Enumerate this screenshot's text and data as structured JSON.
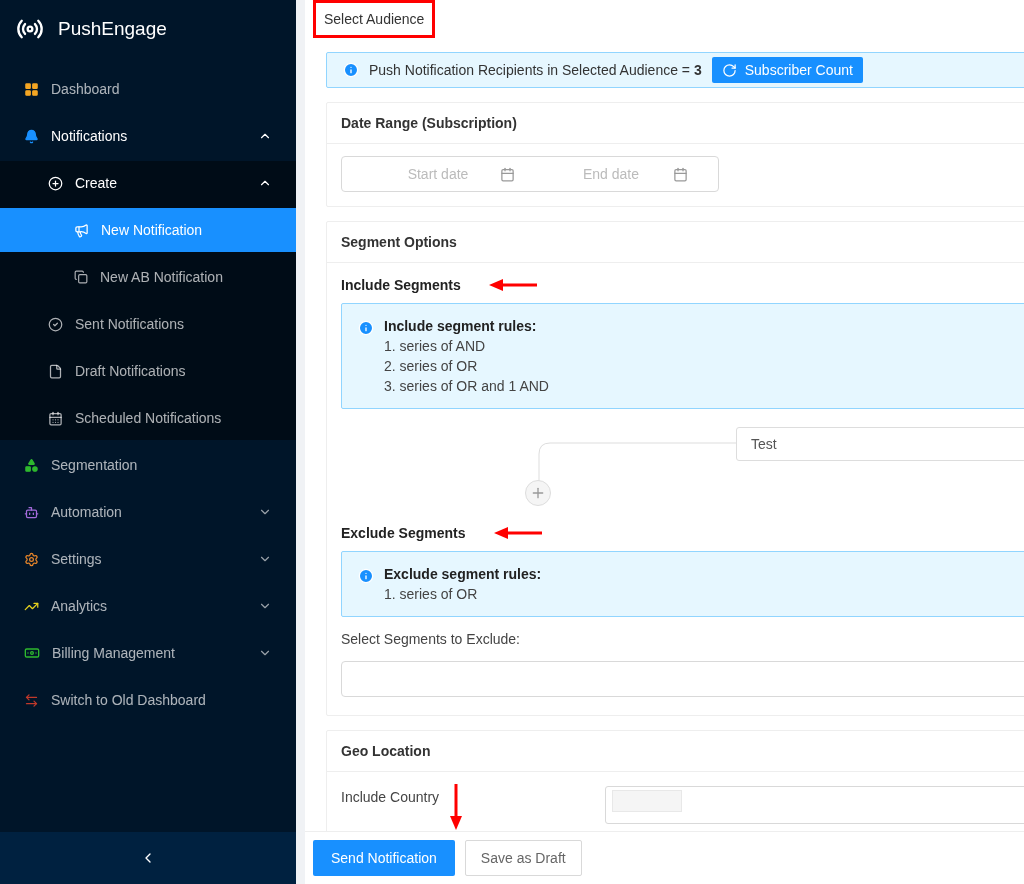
{
  "sidebar": {
    "brand": "PushEngage",
    "items": [
      {
        "label": "Dashboard",
        "selected": false
      },
      {
        "label": "Notifications",
        "selected": false,
        "expanded": true,
        "children": [
          {
            "label": "Create",
            "selected": false,
            "expanded": true,
            "children": [
              {
                "label": "New Notification",
                "selected": true
              },
              {
                "label": "New AB Notification",
                "selected": false
              }
            ]
          },
          {
            "label": "Sent Notifications",
            "selected": false
          },
          {
            "label": "Draft Notifications",
            "selected": false
          },
          {
            "label": "Scheduled Notifications",
            "selected": false
          }
        ]
      },
      {
        "label": "Segmentation",
        "selected": false
      },
      {
        "label": "Automation",
        "selected": false,
        "expanded": false
      },
      {
        "label": "Settings",
        "selected": false,
        "expanded": false
      },
      {
        "label": "Analytics",
        "selected": false,
        "expanded": false
      },
      {
        "label": "Billing Management",
        "selected": false,
        "expanded": false
      },
      {
        "label": "Switch to Old Dashboard",
        "selected": false
      }
    ]
  },
  "main": {
    "title": "Select Audience",
    "audience_info": {
      "text": "Push Notification Recipients in Selected Audience = **3**",
      "button": "Subscriber Count"
    },
    "date_range": {
      "title": "Date Range (Subscription)",
      "start_placeholder": "Start date",
      "end_placeholder": "End date"
    },
    "segment_options": {
      "title": "Segment Options",
      "include": {
        "heading": "Include Segments",
        "rules_title": "Include segment rules:",
        "rules": [
          "1. series of AND",
          "2. series of OR",
          "3. series of OR and 1 AND"
        ],
        "segments": [
          "Test"
        ]
      },
      "exclude": {
        "heading": "Exclude Segments",
        "rules_title": "Exclude segment rules:",
        "rules": [
          "1. series of OR"
        ],
        "select_label": "Select Segments to Exclude:"
      }
    },
    "geo_location": {
      "title": "Geo Location",
      "include_country_label": "Include Country"
    }
  },
  "footer": {
    "buttons": [
      {
        "label": "Send Notification",
        "kind": "primary"
      },
      {
        "label": "Save as Draft",
        "kind": "default"
      }
    ]
  }
}
